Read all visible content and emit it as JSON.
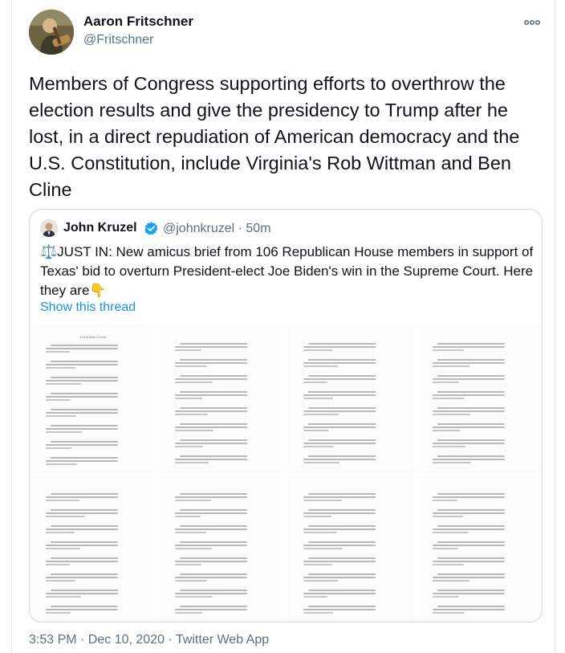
{
  "tweet": {
    "author_name": "Aaron Fritschner",
    "author_handle": "@Fritschner",
    "text": "Members of Congress supporting efforts to overthrow the election results and give the presidency to Trump after he lost, in a direct repudiation of American democracy and the U.S. Constitution, include Virginia's Rob Wittman and Ben Cline",
    "more_icon": "ellipsis-icon",
    "meta": "3:53 PM · Dec 10, 2020 · Twitter Web App"
  },
  "quote": {
    "author_name": "John Kruzel",
    "verified_icon": "verified-badge-icon",
    "author_handle_time": "@johnkruzel · 50m",
    "text": "⚖️JUST IN: New amicus brief from 106 Republican House members in support of Texas' bid to overturn President-elect Joe Biden's win in the Supreme Court. Here they are👇",
    "show_thread": "Show this thread",
    "image_grid": {
      "columns": 4,
      "rows": 2,
      "pages": [
        {
          "heading": "List of Amici Curiae"
        },
        {},
        {},
        {},
        {},
        {},
        {},
        {}
      ]
    }
  },
  "colors": {
    "primary_text": "#0f1419",
    "secondary_text": "#5b7083",
    "link": "#1b95e0",
    "border": "#cfd9de",
    "verified": "#1da1f2"
  }
}
